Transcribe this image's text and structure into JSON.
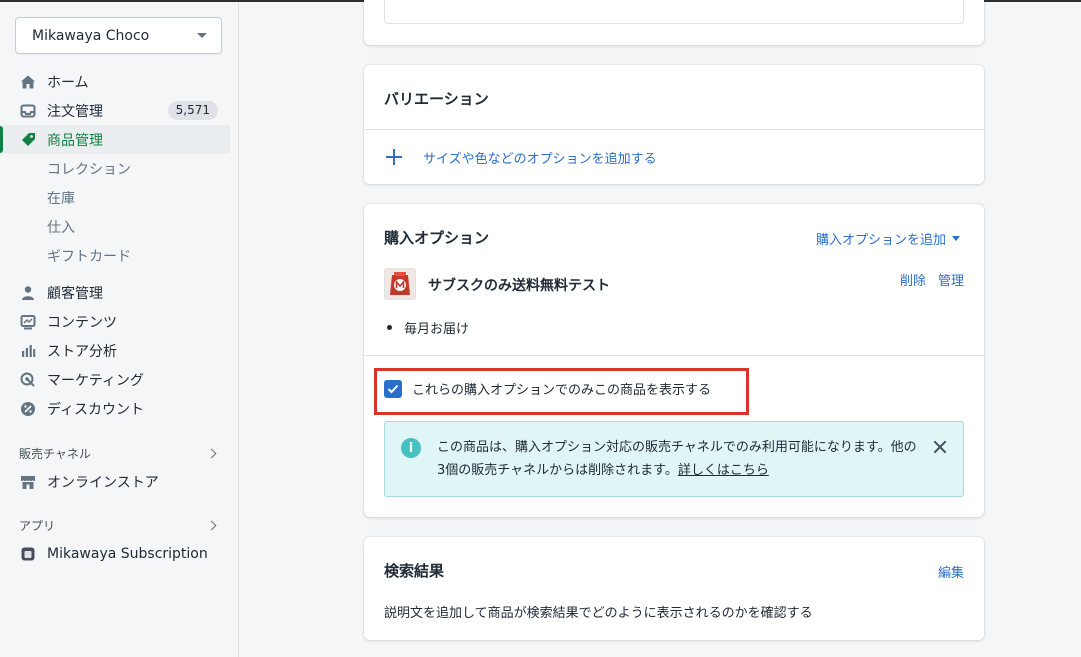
{
  "sidebar": {
    "store_name": "Mikawaya Choco",
    "nav": [
      {
        "label": "ホーム",
        "icon": "home-icon"
      },
      {
        "label": "注文管理",
        "icon": "inbox-icon",
        "badge": "5,571"
      },
      {
        "label": "商品管理",
        "icon": "tag-icon",
        "active": true
      }
    ],
    "product_sub": [
      "コレクション",
      "在庫",
      "仕入",
      "ギフトカード"
    ],
    "nav2": [
      {
        "label": "顧客管理",
        "icon": "person-icon"
      },
      {
        "label": "コンテンツ",
        "icon": "content-icon"
      },
      {
        "label": "ストア分析",
        "icon": "analytics-icon"
      },
      {
        "label": "マーケティング",
        "icon": "marketing-icon"
      },
      {
        "label": "ディスカウント",
        "icon": "discount-icon"
      }
    ],
    "sales_channels_label": "販売チャネル",
    "online_store_label": "オンラインストア",
    "apps_label": "アプリ",
    "app_item_label": "Mikawaya Subscription"
  },
  "variants": {
    "title": "バリエーション",
    "add_option": "サイズや色などのオプションを追加する"
  },
  "purchase_options": {
    "title": "購入オプション",
    "add_link": "購入オプションを追加",
    "plan_name": "サブスクのみ送料無料テスト",
    "delete_label": "削除",
    "manage_label": "管理",
    "bullet": "毎月お届け",
    "checkbox_label": "これらの購入オプションでのみこの商品を表示する",
    "checkbox_checked": true,
    "banner_text": "この商品は、購入オプション対応の販売チャネルでのみ利用可能になります。他の3個の販売チャネルからは削除されます。",
    "banner_link": "詳しくはこちら"
  },
  "seo": {
    "title": "検索結果",
    "edit_label": "編集",
    "description": "説明文を追加して商品が検索結果でどのように表示されるのかを確認する"
  },
  "colors": {
    "accent_green": "#108043",
    "link_blue": "#2c6ecb",
    "highlight_red": "#d9342b",
    "banner_bg": "#e0f5f5"
  }
}
